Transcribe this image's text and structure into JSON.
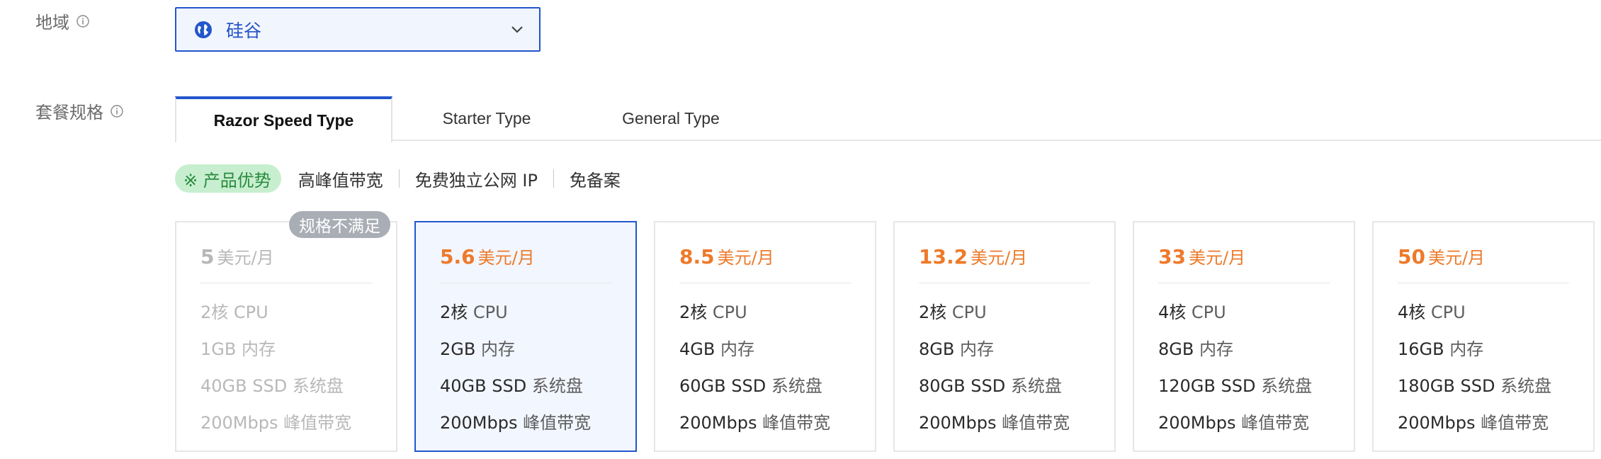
{
  "region": {
    "label": "地域",
    "value": "硅谷"
  },
  "package": {
    "label": "套餐规格",
    "tabs": [
      {
        "label": "Razor Speed Type"
      },
      {
        "label": "Starter Type"
      },
      {
        "label": "General Type"
      }
    ],
    "active_tab": "Razor Speed Type"
  },
  "advantages": {
    "badge": "※ 产品优势",
    "items": [
      "高峰值带宽",
      "免费独立公网 IP",
      "免备案"
    ]
  },
  "unavailable_badge": "规格不满足",
  "plans": [
    {
      "price": "5",
      "unit": "美元/月",
      "cpu": "2核",
      "cpu_unit": "CPU",
      "mem": "1GB",
      "mem_unit": "内存",
      "disk": "40GB SSD",
      "disk_unit": "系统盘",
      "bw": "200Mbps",
      "bw_unit": "峰值带宽",
      "state": "disabled"
    },
    {
      "price": "5.6",
      "unit": "美元/月",
      "cpu": "2核",
      "cpu_unit": "CPU",
      "mem": "2GB",
      "mem_unit": "内存",
      "disk": "40GB SSD",
      "disk_unit": "系统盘",
      "bw": "200Mbps",
      "bw_unit": "峰值带宽",
      "state": "selected"
    },
    {
      "price": "8.5",
      "unit": "美元/月",
      "cpu": "2核",
      "cpu_unit": "CPU",
      "mem": "4GB",
      "mem_unit": "内存",
      "disk": "60GB SSD",
      "disk_unit": "系统盘",
      "bw": "200Mbps",
      "bw_unit": "峰值带宽",
      "state": "normal"
    },
    {
      "price": "13.2",
      "unit": "美元/月",
      "cpu": "2核",
      "cpu_unit": "CPU",
      "mem": "8GB",
      "mem_unit": "内存",
      "disk": "80GB SSD",
      "disk_unit": "系统盘",
      "bw": "200Mbps",
      "bw_unit": "峰值带宽",
      "state": "normal"
    },
    {
      "price": "33",
      "unit": "美元/月",
      "cpu": "4核",
      "cpu_unit": "CPU",
      "mem": "8GB",
      "mem_unit": "内存",
      "disk": "120GB SSD",
      "disk_unit": "系统盘",
      "bw": "200Mbps",
      "bw_unit": "峰值带宽",
      "state": "normal"
    },
    {
      "price": "50",
      "unit": "美元/月",
      "cpu": "4核",
      "cpu_unit": "CPU",
      "mem": "16GB",
      "mem_unit": "内存",
      "disk": "180GB SSD",
      "disk_unit": "系统盘",
      "bw": "200Mbps",
      "bw_unit": "峰值带宽",
      "state": "normal"
    }
  ],
  "icons": {
    "info": "info-icon",
    "region": "globe-icon",
    "dropdown": "chevron-down-icon"
  },
  "colors": {
    "accent": "#2256cc",
    "price": "#ee7a2a",
    "advantage_badge_bg": "#c7efcf",
    "advantage_badge_text": "#2a8a3e",
    "unavailable_badge_bg": "#a9adb5"
  }
}
